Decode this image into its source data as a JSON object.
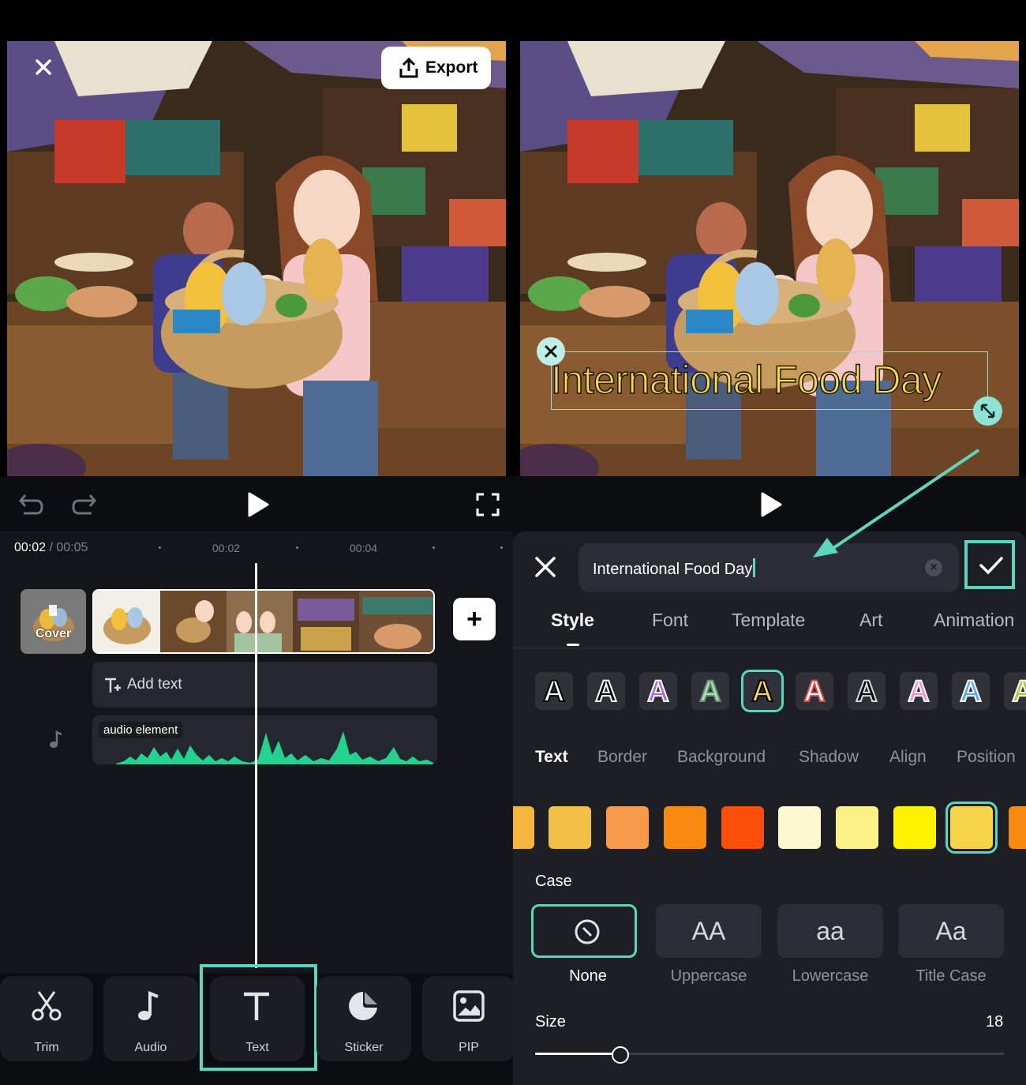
{
  "left": {
    "close_icon": "close-icon",
    "export_label": "Export",
    "time_current": "00:02",
    "time_total": "/ 00:05",
    "ticks": [
      "00:02",
      "00:04"
    ],
    "cover_label": "Cover",
    "add_text_label": "Add text",
    "audio_label": "audio element",
    "toolbar": [
      {
        "label": "Trim",
        "icon": "scissors-icon"
      },
      {
        "label": "Audio",
        "icon": "music-note-icon"
      },
      {
        "label": "Text",
        "icon": "text-icon"
      },
      {
        "label": "Sticker",
        "icon": "sticker-icon"
      },
      {
        "label": "PIP",
        "icon": "image-icon"
      }
    ]
  },
  "right": {
    "overlay_text": "International Food Day",
    "input_value": "International Food Day",
    "tabs": [
      "Style",
      "Font",
      "Template",
      "Art",
      "Animation"
    ],
    "style_glyph": "A",
    "subtabs": [
      "Text",
      "Border",
      "Background",
      "Shadow",
      "Align",
      "Position"
    ],
    "colors": [
      "#f5b63e",
      "#f2be45",
      "#f79a4a",
      "#f98a0f",
      "#fb4e0a",
      "#fdf8d0",
      "#fbf286",
      "#fdf200",
      "#f5d44a",
      "#f98a0f"
    ],
    "case_title": "Case",
    "case_options": [
      {
        "glyph": "",
        "label": "None"
      },
      {
        "glyph": "AA",
        "label": "Uppercase"
      },
      {
        "glyph": "aa",
        "label": "Lowercase"
      },
      {
        "glyph": "Aa",
        "label": "Title Case"
      }
    ],
    "size_label": "Size",
    "size_value": "18",
    "accent_color": "#5cd6bf"
  }
}
